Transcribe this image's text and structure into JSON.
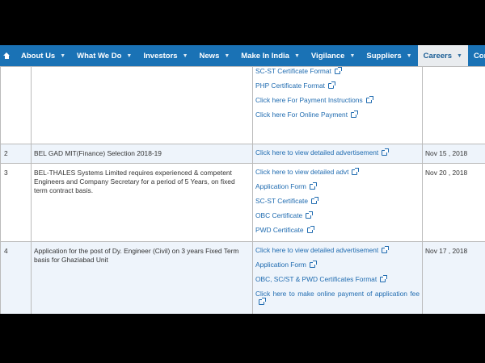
{
  "nav": {
    "items": [
      {
        "label": "About Us"
      },
      {
        "label": "What We Do"
      },
      {
        "label": "Investors"
      },
      {
        "label": "News"
      },
      {
        "label": "Make In India"
      },
      {
        "label": "Vigilance"
      },
      {
        "label": "Suppliers"
      },
      {
        "label": "Careers"
      },
      {
        "label": "Contact Us"
      }
    ]
  },
  "rows": [
    {
      "sn": "",
      "title": "",
      "date": "",
      "links": [
        "SC-ST Certificate Format",
        "PHP Certificate Format",
        "Click here For Payment Instructions",
        "Click here For Online Payment"
      ]
    },
    {
      "sn": "2",
      "title": "BEL GAD MIT(Finance) Selection 2018-19",
      "date": "Nov 15 , 2018",
      "links": [
        "Click here to view detailed advertisement"
      ]
    },
    {
      "sn": "3",
      "title": "BEL-THALES Systems Limited requires experienced & competent Engineers and Company Secretary for a period of 5 Years, on fixed term contract basis.",
      "date": "Nov 20 , 2018",
      "links": [
        "Click here to view detailed advt",
        "Application Form",
        "SC-ST Certificate",
        "OBC Certificate",
        "PWD Certificate"
      ]
    },
    {
      "sn": "4",
      "title": "Application for the post of Dy. Engineer (Civil) on 3 years Fixed Term basis for Ghaziabad Unit",
      "date": "Nov 17 , 2018",
      "links": [
        "Click here to view detailed advertisement",
        "Application Form",
        "OBC, SC/ST & PWD Certificates Format",
        "Click here to make online payment of application fee"
      ]
    }
  ]
}
